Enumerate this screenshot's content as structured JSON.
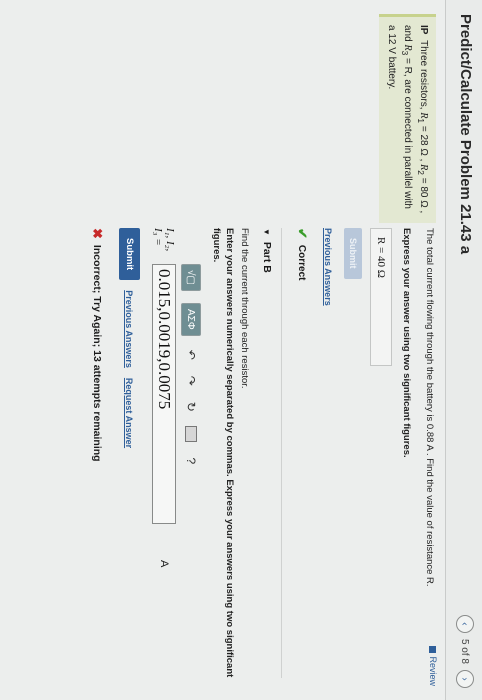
{
  "header": {
    "title": "Predict/Calculate Problem 21.43 a",
    "page_indicator": "5 of 8",
    "prev_icon": "chevron-left-icon",
    "next_icon": "chevron-right-icon"
  },
  "review_link": "Review",
  "problem": {
    "label": "IP",
    "text_1": "Three resistors, ",
    "r1": "R",
    "r1_sub": "1",
    "text_2": " = 28 Ω , ",
    "r2": "R",
    "r2_sub": "2",
    "text_3": " = 80 Ω , and",
    "r3": "R",
    "r3_sub": "3",
    "text_4": " = R, are connected in parallel with a 12 V battery."
  },
  "part_a": {
    "prompt": "The total current flowing through the battery is 0.88 A . Find the value of resistance R.",
    "instruction": "Express your answer using two significant figures.",
    "answer": "R =  40  Ω",
    "submit_label": "Submit",
    "previous_answers": "Previous Answers",
    "status": "Correct",
    "status_icon": "check-icon"
  },
  "part_b": {
    "label": "Part B",
    "prompt": "Find the current through each resistor.",
    "instruction": "Enter your answers numerically separated by commas. Express your answers using two significant figures.",
    "toolbar": {
      "templates": "√▢",
      "symbols": "ΑΣΦ",
      "undo_icon": "undo-icon",
      "redo_icon": "redo-icon",
      "reset_icon": "reset-icon",
      "keyboard_icon": "keyboard-icon",
      "help": "?"
    },
    "variables": "I₁, I₂, I₃ =",
    "answer_value": "0.015,0.0019,0.0075",
    "unit": "A",
    "submit_label": "Submit",
    "previous_answers": "Previous Answers",
    "request_answer": "Request Answer",
    "feedback": "Incorrect; Try Again; 13 attempts remaining",
    "feedback_icon": "x-icon"
  }
}
